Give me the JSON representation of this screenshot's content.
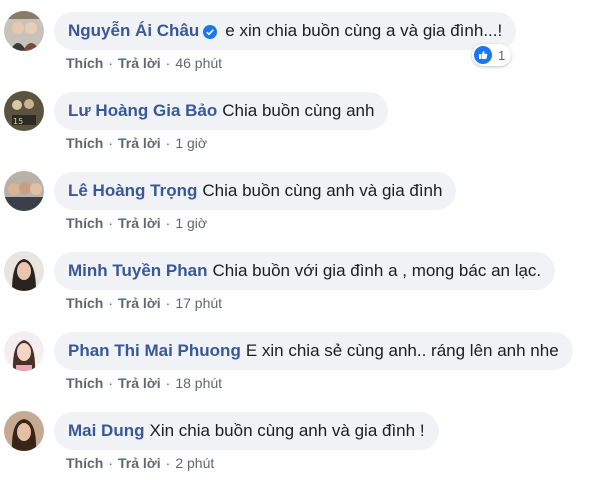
{
  "actions": {
    "like": "Thích",
    "reply": "Trả lời",
    "separator": "·"
  },
  "comments": [
    {
      "name": "Nguyễn Ái Châu",
      "verified": true,
      "text": "e xin chia buồn cùng a và gia đình...!",
      "time": "46 phút",
      "reactions": {
        "icon": "like-icon",
        "count": "1"
      }
    },
    {
      "name": "Lư Hoàng Gia Bảo",
      "text": "Chia buồn cùng anh",
      "time": "1 giờ"
    },
    {
      "name": "Lê Hoàng Trọng",
      "text": "Chia buồn cùng anh và gia đình",
      "time": "1 giờ"
    },
    {
      "name": "Minh Tuyền Phan",
      "text": "Chia buồn với gia đình a , mong bác an lạc.",
      "time": "17 phút"
    },
    {
      "name": "Phan Thi Mai Phuong",
      "text": "E xin chia sẻ cùng anh.. ráng lên anh nhe",
      "time": "18 phút"
    },
    {
      "name": "Mai Dung",
      "text": "Xin chia buồn cùng anh và gia đình !",
      "time": "2 phút"
    }
  ],
  "colors": {
    "name": "#385898",
    "bubble": "#f0f2f5",
    "meta": "#606770",
    "like": "#1877f2"
  }
}
